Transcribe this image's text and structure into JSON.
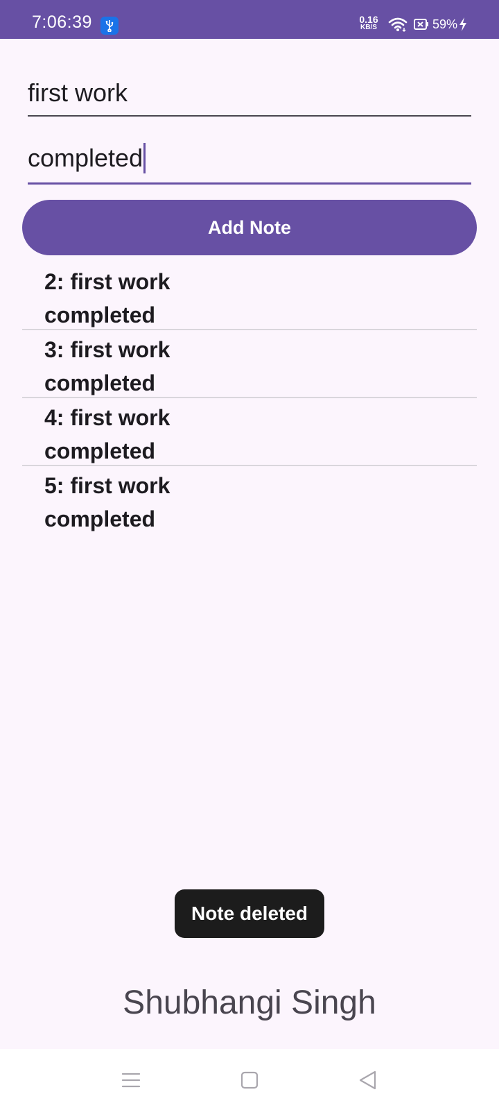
{
  "status_bar": {
    "time": "7:06:39",
    "net_speed_value": "0.16",
    "net_speed_unit": "KB/S",
    "battery": "59%",
    "icons": [
      "usb-icon",
      "wifi-icon",
      "battery-x-icon",
      "charging-icon"
    ]
  },
  "form": {
    "title_value": "first work",
    "content_value": "completed",
    "add_button_label": "Add Note"
  },
  "notes": [
    {
      "title": "2: first work",
      "body": "completed"
    },
    {
      "title": "3: first work",
      "body": "completed"
    },
    {
      "title": "4: first work",
      "body": "completed"
    },
    {
      "title": "5: first work",
      "body": "completed"
    }
  ],
  "toast": "Note deleted",
  "author": "Shubhangi Singh",
  "colors": {
    "primary": "#6750a4",
    "background": "#fcf5fd",
    "toast": "#1c1c1c"
  },
  "nav_bar": {
    "icons": [
      "menu-icon",
      "home-icon",
      "back-icon"
    ]
  }
}
